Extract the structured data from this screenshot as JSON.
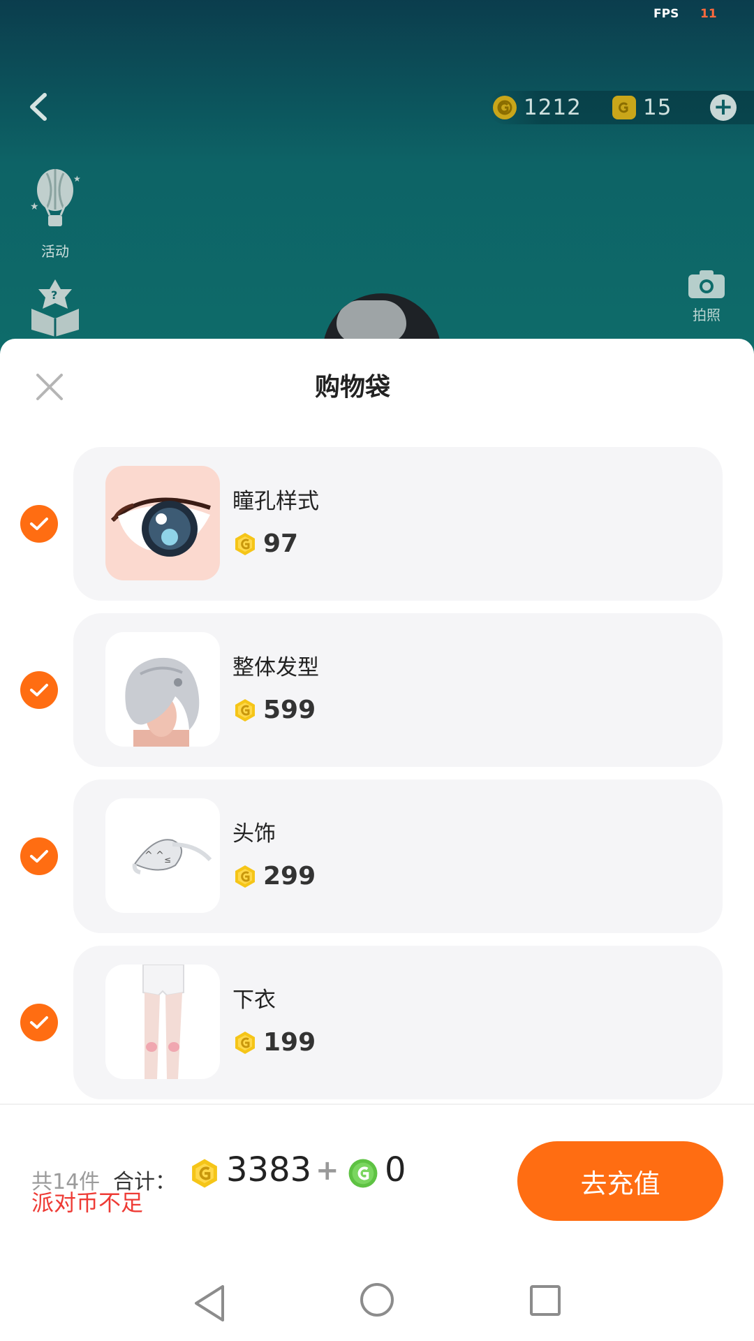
{
  "status": {
    "fps_label": "FPS",
    "fps_value": "11"
  },
  "header": {
    "back_icon": "chevron-left-icon",
    "gold_coins": "1212",
    "premium_coins": "15",
    "add_icon": "plus-circle-icon"
  },
  "side_menu": {
    "activity_label": "活动",
    "camera_label": "拍照"
  },
  "sheet": {
    "title": "购物袋",
    "close_icon": "close-icon",
    "items": [
      {
        "name": "瞳孔样式",
        "price": "97",
        "checked": true
      },
      {
        "name": "整体发型",
        "price": "599",
        "checked": true
      },
      {
        "name": "头饰",
        "price": "299",
        "checked": true
      },
      {
        "name": "下衣",
        "price": "199",
        "checked": true
      }
    ],
    "footer": {
      "count_text": "共14件",
      "total_label": "合计：",
      "total_gold": "3383",
      "plus": "+",
      "total_green": "0",
      "warning": "派对币不足",
      "recharge_label": "去充值"
    }
  },
  "colors": {
    "accent": "#ff6d12",
    "warning": "#ee3b35",
    "gold_coin": "#f5c518",
    "green_coin": "#5ec243"
  }
}
